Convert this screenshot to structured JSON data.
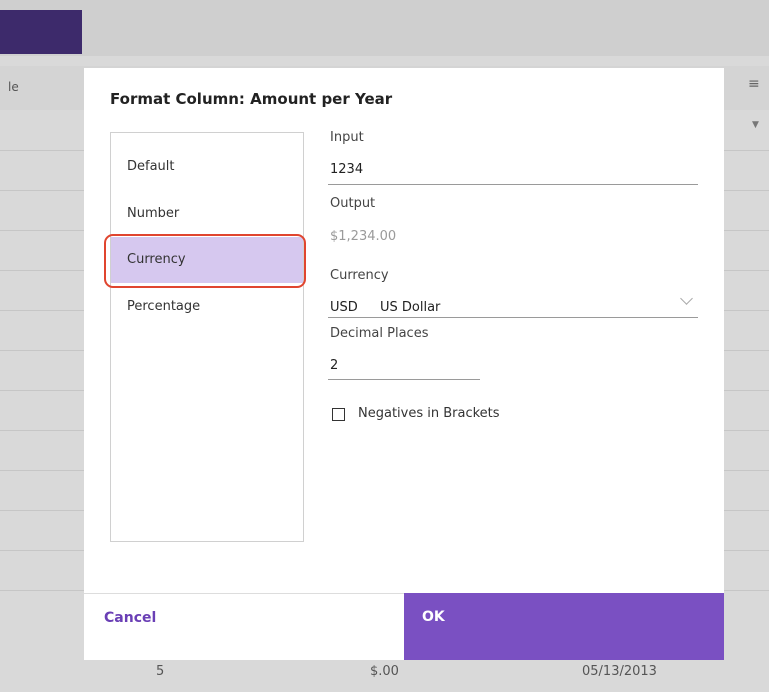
{
  "background": {
    "column_header": "le",
    "last_row": {
      "col1": "5",
      "col2": "$.00",
      "col3": "05/13/2013"
    },
    "menu_icon": "hamburger-icon",
    "filter_icon": "filter-icon"
  },
  "dialog": {
    "title": "Format Column: Amount per Year",
    "format_types": [
      "Default",
      "Number",
      "Currency",
      "Percentage"
    ],
    "selected_format": "Currency",
    "input_label": "Input",
    "input_value": "1234",
    "output_label": "Output",
    "output_value": "$1,234.00",
    "currency_label": "Currency",
    "currency_code": "USD",
    "currency_name": "US Dollar",
    "decimal_label": "Decimal Places",
    "decimal_value": "2",
    "negatives_label": "Negatives in Brackets",
    "negatives_checked": false,
    "cancel_label": "Cancel",
    "ok_label": "OK"
  },
  "colors": {
    "accent": "#7a50c2",
    "selected_item": "#d6c8ef",
    "highlight_ring": "#e0452f"
  }
}
